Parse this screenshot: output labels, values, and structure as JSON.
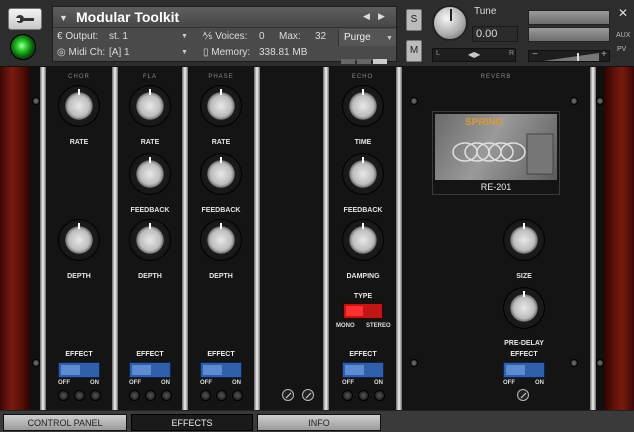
{
  "header": {
    "instrument_name": "Modular Toolkit",
    "output_label": "Output:",
    "output_value": "st. 1",
    "voices_label": "Voices:",
    "voices_value": "0",
    "max_label": "Max:",
    "max_value": "32",
    "purge_label": "Purge",
    "midi_label": "Midi Ch:",
    "midi_value": "[A]  1",
    "memory_label": "Memory:",
    "memory_value": "338.81 MB",
    "solo_label": "S",
    "mute_label": "M",
    "tune_label": "Tune",
    "tune_value": "0.00",
    "pan_left": "L",
    "pan_right": "R",
    "aux_label": "AUX",
    "pv_label": "PV"
  },
  "modules": {
    "chor": {
      "title": "CHOR",
      "knob1": "RATE",
      "knob2": "DEPTH",
      "effect": "EFFECT",
      "off": "OFF",
      "on": "ON"
    },
    "fla": {
      "title": "FLA",
      "knob1": "RATE",
      "knob2": "FEEDBACK",
      "knob3": "DEPTH",
      "effect": "EFFECT",
      "off": "OFF",
      "on": "ON"
    },
    "phase": {
      "title": "PHASE",
      "knob1": "RATE",
      "knob2": "FEEDBACK",
      "knob3": "DEPTH",
      "effect": "EFFECT",
      "off": "OFF",
      "on": "ON"
    },
    "echo": {
      "title": "ECHO",
      "knob1": "TIME",
      "knob2": "FEEDBACK",
      "knob3": "DAMPING",
      "type_label": "TYPE",
      "mono": "MONO",
      "stereo": "STEREO",
      "effect": "EFFECT",
      "off": "OFF",
      "on": "ON"
    },
    "reverb": {
      "title": "REVERB",
      "display_logo": "SPRING",
      "display_name": "RE-201",
      "knob1": "SIZE",
      "knob2": "PRE-DELAY",
      "effect": "EFFECT",
      "off": "OFF",
      "on": "ON"
    }
  },
  "tabs": [
    {
      "label": "CONTROL PANEL"
    },
    {
      "label": "EFFECTS"
    },
    {
      "label": "INFO"
    }
  ],
  "colors": {
    "toggle_blue": "#2f5fa8",
    "type_red": "#c01616",
    "power_led": "#30d030"
  }
}
